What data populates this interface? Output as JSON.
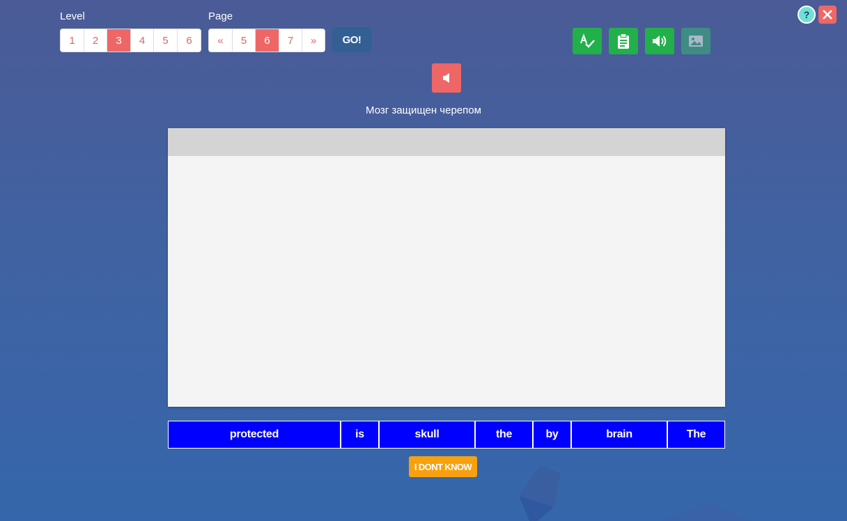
{
  "level": {
    "label": "Level",
    "items": [
      "1",
      "2",
      "3",
      "4",
      "5",
      "6"
    ],
    "selected": "3"
  },
  "page": {
    "label": "Page",
    "prev": "«",
    "items": [
      "5",
      "6",
      "7"
    ],
    "next": "»",
    "selected": "6"
  },
  "go_label": "GO!",
  "tools": [
    {
      "name": "spellcheck-icon"
    },
    {
      "name": "clipboard-icon"
    },
    {
      "name": "volume-icon"
    },
    {
      "name": "image-icon"
    }
  ],
  "help_label": "?",
  "prompt": "Мозг защищен черепом",
  "words": [
    "protected",
    "is",
    "skull",
    "the",
    "by",
    "brain",
    "The"
  ],
  "idk_label": "I DONT KNOW",
  "colors": {
    "accent": "#ef6666",
    "green": "#22b04b",
    "word_bg": "#0000ff",
    "idk": "#f7a10f"
  }
}
